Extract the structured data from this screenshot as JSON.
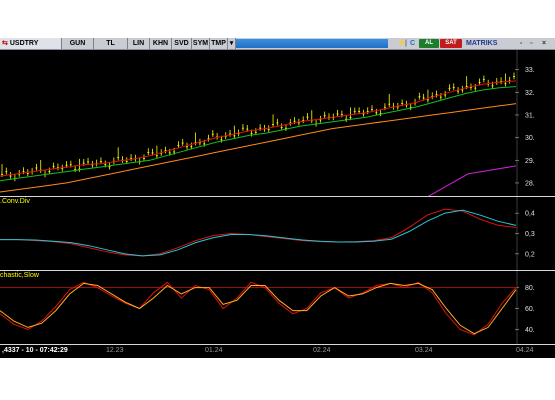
{
  "toolbar": {
    "symbol": "USDTRY",
    "tools": [
      "GUN",
      "TL",
      "LIN",
      "KHN",
      "SVD",
      "SYM",
      "TMP"
    ],
    "buy_label": "AL",
    "sell_label": "SAT",
    "brand": "MATRIKS"
  },
  "panels": {
    "stoch_label": "chastic,Slow",
    "conv_label": ".Conv.Div"
  },
  "status": {
    "readout": ",4337 - 10 - 07:42:29",
    "x_labels": [
      "12.23",
      "01.24",
      "02.24",
      "03.24",
      "04.24"
    ]
  },
  "colors": {
    "candle": "#ffff00",
    "ma_fast": "#e01010",
    "ma_mid": "#10c020",
    "ma_slow": "#ff8a1a",
    "ma_far": "#d020d0",
    "osc_a": "#e01010",
    "osc_b": "#20c8d8",
    "stoch_k": "#e01010",
    "stoch_d": "#ffb020",
    "ref_line": "#b01010"
  },
  "chart_data": [
    {
      "type": "line",
      "title": "USDTRY",
      "y_ticks": [
        28,
        29,
        30,
        31,
        32,
        33
      ],
      "ylim": [
        27.6,
        33.6
      ],
      "series": [
        {
          "name": "",
          "values": [
            28.3,
            28.4,
            28.5,
            28.6,
            28.7,
            28.8,
            28.85,
            28.95,
            29.05,
            29.2,
            29.4,
            29.6,
            29.8,
            30.0,
            30.15,
            30.3,
            30.4,
            30.55,
            30.7,
            30.8,
            30.9,
            31.0,
            31.1,
            31.25,
            31.4,
            31.55,
            31.8,
            32.0,
            32.2,
            32.35,
            32.45,
            32.5
          ]
        },
        {
          "name": "",
          "values": [
            28.1,
            28.2,
            28.3,
            28.4,
            28.5,
            28.6,
            28.7,
            28.8,
            28.9,
            29.0,
            29.2,
            29.4,
            29.6,
            29.8,
            29.95,
            30.1,
            30.2,
            30.35,
            30.5,
            30.6,
            30.7,
            30.8,
            30.9,
            31.05,
            31.2,
            31.35,
            31.55,
            31.75,
            31.95,
            32.1,
            32.2,
            32.25
          ]
        },
        {
          "name": "",
          "values": [
            27.6,
            27.7,
            27.8,
            27.9,
            28.0,
            28.15,
            28.3,
            28.45,
            28.6,
            28.75,
            28.9,
            29.05,
            29.2,
            29.35,
            29.5,
            29.65,
            29.8,
            29.95,
            30.1,
            30.25,
            30.4,
            30.5,
            30.6,
            30.7,
            30.8,
            30.9,
            31.0,
            31.1,
            31.2,
            31.3,
            31.4,
            31.5
          ]
        }
      ],
      "far_series": [
        27.2,
        28.4,
        28.75
      ]
    },
    {
      "type": "line",
      "title": ".Conv.Div",
      "y_ticks": [
        0.2,
        0.3,
        0.4
      ],
      "ylim": [
        0.15,
        0.45
      ],
      "series": [
        {
          "name": "",
          "values": [
            0.27,
            0.27,
            0.265,
            0.26,
            0.25,
            0.23,
            0.21,
            0.195,
            0.19,
            0.2,
            0.23,
            0.265,
            0.29,
            0.3,
            0.295,
            0.285,
            0.275,
            0.265,
            0.26,
            0.258,
            0.26,
            0.265,
            0.28,
            0.33,
            0.39,
            0.42,
            0.41,
            0.37,
            0.34,
            0.33
          ]
        },
        {
          "name": "",
          "values": [
            0.27,
            0.27,
            0.268,
            0.262,
            0.255,
            0.24,
            0.22,
            0.2,
            0.19,
            0.195,
            0.22,
            0.255,
            0.28,
            0.295,
            0.295,
            0.288,
            0.278,
            0.268,
            0.262,
            0.258,
            0.258,
            0.262,
            0.272,
            0.31,
            0.36,
            0.4,
            0.415,
            0.39,
            0.36,
            0.34
          ]
        }
      ]
    },
    {
      "type": "line",
      "title": "chastic,Slow",
      "y_ticks": [
        40,
        60,
        80
      ],
      "ylim": [
        30,
        92
      ],
      "series": [
        {
          "name": "",
          "values": [
            55,
            45,
            40,
            48,
            62,
            78,
            85,
            80,
            72,
            65,
            60,
            75,
            85,
            70,
            82,
            78,
            60,
            70,
            85,
            80,
            65,
            55,
            60,
            75,
            80,
            70,
            75,
            82,
            84,
            80,
            85,
            75,
            55,
            40,
            35,
            45,
            65,
            80
          ]
        },
        {
          "name": "",
          "values": [
            58,
            48,
            42,
            46,
            58,
            74,
            84,
            82,
            74,
            66,
            60,
            70,
            82,
            74,
            80,
            80,
            64,
            68,
            82,
            82,
            68,
            58,
            58,
            72,
            80,
            72,
            74,
            80,
            84,
            82,
            84,
            78,
            60,
            44,
            36,
            42,
            60,
            78
          ]
        }
      ],
      "ref_lines": [
        80
      ]
    }
  ]
}
